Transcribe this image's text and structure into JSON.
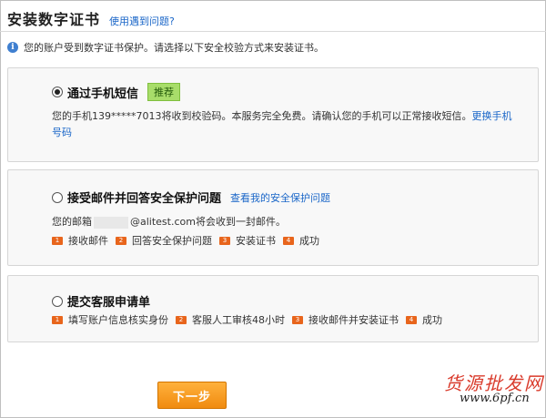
{
  "header": {
    "title": "安装数字证书",
    "help_link": "使用遇到问题?"
  },
  "notice": {
    "icon": "info-icon",
    "text": "您的账户受到数字证书保护。请选择以下安全校验方式来安装证书。"
  },
  "options": [
    {
      "title": "通过手机短信",
      "selected": true,
      "badge": "推荐",
      "desc_line1_pre": "您的手机139*****7013将收到校验码。本服务完全免费。请确认您的手机可以正常接收短信。",
      "change_link_part1": "更换手机",
      "change_link_part2": "号码"
    },
    {
      "title": "接受邮件并回答安全保护问题",
      "selected": false,
      "link": "查看我的安全保护问题",
      "desc_pre": "您的邮箱",
      "desc_post": "@alitest.com将会收到一封邮件。",
      "steps": [
        {
          "num": "1",
          "label": "接收邮件"
        },
        {
          "num": "2",
          "label": "回答安全保护问题"
        },
        {
          "num": "3",
          "label": "安装证书"
        },
        {
          "num": "4",
          "label": "成功"
        }
      ]
    },
    {
      "title": "提交客服申请单",
      "selected": false,
      "steps": [
        {
          "num": "1",
          "label": "填写账户信息核实身份"
        },
        {
          "num": "2",
          "label": "客服人工审核48小时"
        },
        {
          "num": "3",
          "label": "接收邮件并安装证书"
        },
        {
          "num": "4",
          "label": "成功"
        }
      ]
    }
  ],
  "footer": {
    "next_label": "下一步"
  },
  "watermark": {
    "line1": "货源批发网",
    "line2": "www.6pf.cn"
  }
}
